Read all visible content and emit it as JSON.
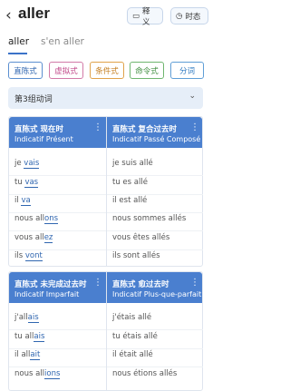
{
  "header": {
    "title": "aller",
    "buttons": [
      {
        "icon": "book-icon",
        "label": "释义"
      },
      {
        "icon": "clock-icon",
        "label": "时态"
      }
    ]
  },
  "word_tabs": [
    {
      "label": "aller",
      "active": true
    },
    {
      "label": "s'en aller",
      "active": false
    }
  ],
  "moods": [
    "直陈式",
    "虚拟式",
    "条件式",
    "命令式",
    "分词"
  ],
  "group_label": "第3组动词",
  "cards": [
    {
      "left": {
        "title_cn": "直陈式 现在时",
        "title_fr": "Indicatif Présent",
        "rows": [
          {
            "pronoun": "je",
            "stem": "",
            "ending": "vais"
          },
          {
            "pronoun": "tu",
            "stem": "",
            "ending": "vas"
          },
          {
            "pronoun": "il",
            "stem": "",
            "ending": "va"
          },
          {
            "pronoun": "nous",
            "stem": "all",
            "ending": "ons"
          },
          {
            "pronoun": "vous",
            "stem": "all",
            "ending": "ez"
          },
          {
            "pronoun": "ils",
            "stem": "",
            "ending": "vont"
          }
        ]
      },
      "right": {
        "title_cn": "直陈式 复合过去时",
        "title_fr": "Indicatif Passé Composé",
        "rows": [
          "je suis allé",
          "tu es allé",
          "il est allé",
          "nous sommes allés",
          "vous êtes allés",
          "ils sont allés"
        ]
      }
    },
    {
      "left": {
        "title_cn": "直陈式 未完成过去时",
        "title_fr": "Indicatif Imparfait",
        "rows": [
          {
            "pronoun": "j'",
            "stem": "all",
            "ending": "ais"
          },
          {
            "pronoun": "tu",
            "stem": "all",
            "ending": "ais"
          },
          {
            "pronoun": "il",
            "stem": "all",
            "ending": "ait"
          },
          {
            "pronoun": "nous",
            "stem": "all",
            "ending": "ions"
          }
        ]
      },
      "right": {
        "title_cn": "直陈式 愈过去时",
        "title_fr": "Indicatif Plus-que-parfait",
        "rows": [
          "j'étais allé",
          "tu étais allé",
          "il était allé",
          "nous étions allés"
        ]
      }
    }
  ],
  "colors": {
    "accent": "#4a7fcf",
    "ending": "#3066b0"
  }
}
